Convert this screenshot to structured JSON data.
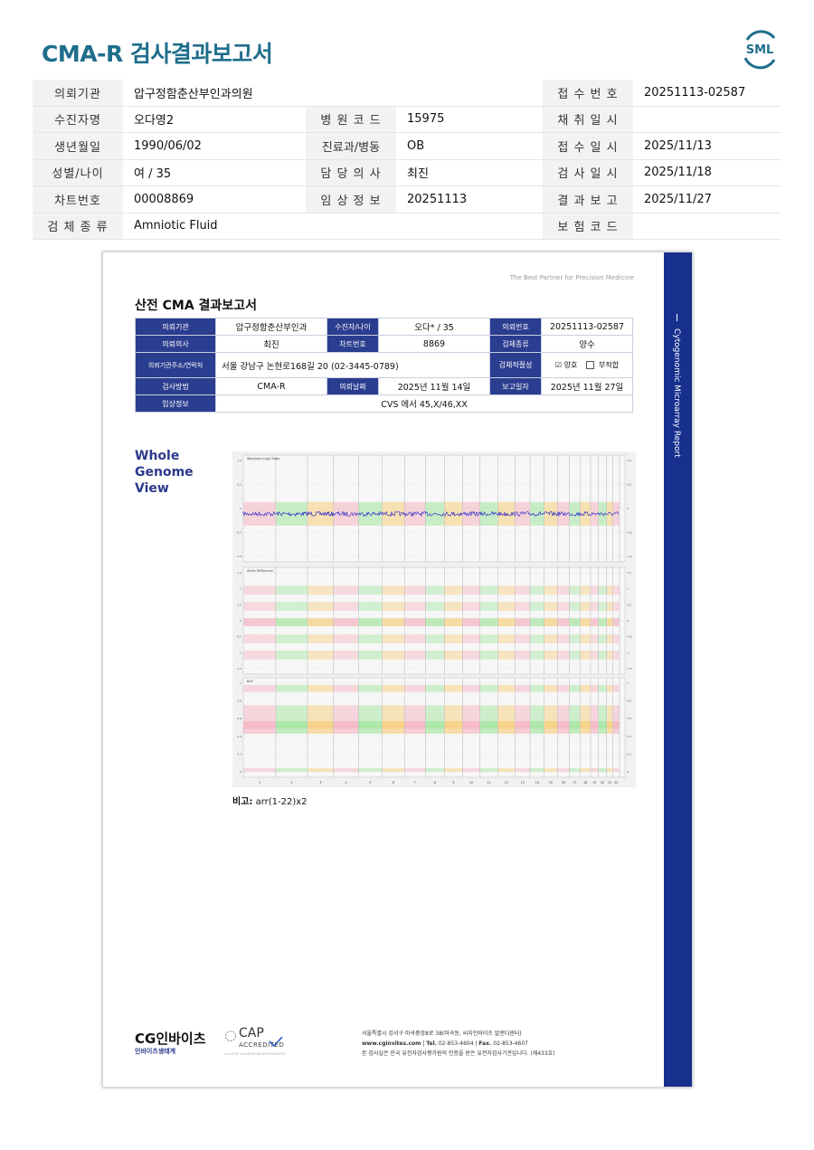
{
  "title": "CMA-R 검사결과보고서",
  "logo_text": "SML",
  "colors": {
    "title": "#1f6e8c",
    "report_blue": "#17308e",
    "header_cell": "#2a3d8f"
  },
  "header": {
    "hospital_label": "의뢰기관",
    "hospital": "압구정함춘산부인과의원",
    "receipt_no_label": "접 수 번 호",
    "receipt_no": "20251113-02587",
    "patient_label": "수진자명",
    "patient": "오다영2",
    "hospital_code_label": "병 원 코 드",
    "hospital_code": "15975",
    "collect_date_label": "채 취 일 시",
    "collect_date": "",
    "birth_label": "생년월일",
    "birth": "1990/06/02",
    "dept_label": "진료과/병동",
    "dept": "OB",
    "receipt_date_label": "접 수 일 시",
    "receipt_date": "2025/11/13",
    "sex_age_label": "성별/나이",
    "sex_age": "여 / 35",
    "doctor_label": "담 당 의 사",
    "doctor": "최진",
    "test_date_label": "검 사 일 시",
    "test_date": "2025/11/18",
    "chart_no_label": "차트번호",
    "chart_no": "00008869",
    "clinical_label": "임 상 정 보",
    "clinical": "20251113",
    "report_date_label": "결 과 보 고",
    "report_date": "2025/11/27",
    "specimen_label": "검 체 종 류",
    "specimen": "Amniotic Fluid",
    "insurance_label": "보 험 코 드",
    "insurance": ""
  },
  "report": {
    "tagline": "The Best Partner for Precision Medicine",
    "sidebar_text": "Cytogenomic Microarray Report",
    "title": "산전 CMA 결과보고서",
    "rows": {
      "inst_label": "의뢰기관",
      "inst": "압구정함춘산부인과",
      "pt_label": "수진자/나이",
      "pt": "오다* / 35",
      "reqno_label": "의뢰번호",
      "reqno": "20251113-02587",
      "doc_label": "의뢰의사",
      "doc": "최진",
      "chart_label": "차트번호",
      "chart": "8869",
      "spec_label": "검체종류",
      "spec": "양수",
      "addr_label": "의뢰기관주소/연락처",
      "addr": "서울 강남구 논현로168길 20 (02-3445-0789)",
      "adequacy_label": "검체적절성",
      "adequacy_ok": "양호",
      "adequacy_bad": "부적합",
      "method_label": "검사방법",
      "method": "CMA-R",
      "reqdate_label": "의뢰날짜",
      "reqdate": "2025년 11월 14일",
      "repdate_label": "보고일자",
      "repdate": "2025년 11월 27일",
      "clin_label": "임상정보",
      "clin": "CVS 에서 45,X/46,XX"
    },
    "section_title": "Whole Genome View",
    "note_label": "비고:",
    "note": "arr(1-22)x2",
    "footer": {
      "cg_logo": "CG인바이츠",
      "cg_sub": "인바이츠생태계",
      "cap_text": "CAP",
      "cap_sub": "ACCREDITED",
      "cap_fine": "COLLEGE of AMERICAN PATHOLOGISTS",
      "addr1": "서울특별시 강서구 마곡중앙8로 38(마곡동, 씨지인바이츠 알앤디센터)",
      "web": "www.cginvites.com",
      "tel_label": "Tel.",
      "tel": "02-853-4604",
      "fax_label": "Fax.",
      "fax": "02-853-4607",
      "cert": "본 검사실은 한국 유전자검사평가원의 인증을 받은 유전자검사기관입니다. (제433호)"
    }
  },
  "chart_data": {
    "type": "scatter",
    "panels": [
      {
        "title": "Weighted Log2 Ratio",
        "ylim": [
          -1,
          1
        ],
        "yticks": [
          "1.0",
          "0.5",
          "0",
          "-0.5",
          "-1.0"
        ]
      },
      {
        "title": "Allele Difference",
        "ylim": [
          -1.5,
          1.5
        ],
        "yticks": [
          "1.5",
          "1",
          "0.5",
          "0",
          "-0.5",
          "-1",
          "-1.5"
        ]
      },
      {
        "title": "BAF",
        "ylim": [
          0,
          1
        ],
        "yticks": [
          "1",
          "0.8",
          "0.6",
          "0.4",
          "0.2",
          "0"
        ]
      }
    ],
    "chromosomes": [
      "1",
      "2",
      "3",
      "4",
      "5",
      "6",
      "7",
      "8",
      "9",
      "10",
      "11",
      "12",
      "13",
      "14",
      "15",
      "16",
      "17",
      "18",
      "19",
      "20",
      "21",
      "22",
      "X",
      "Y"
    ],
    "chrom_colors": [
      "#f4a3b3",
      "#8fe08a",
      "#f7c45c"
    ],
    "trend_color": "#2323c8"
  }
}
